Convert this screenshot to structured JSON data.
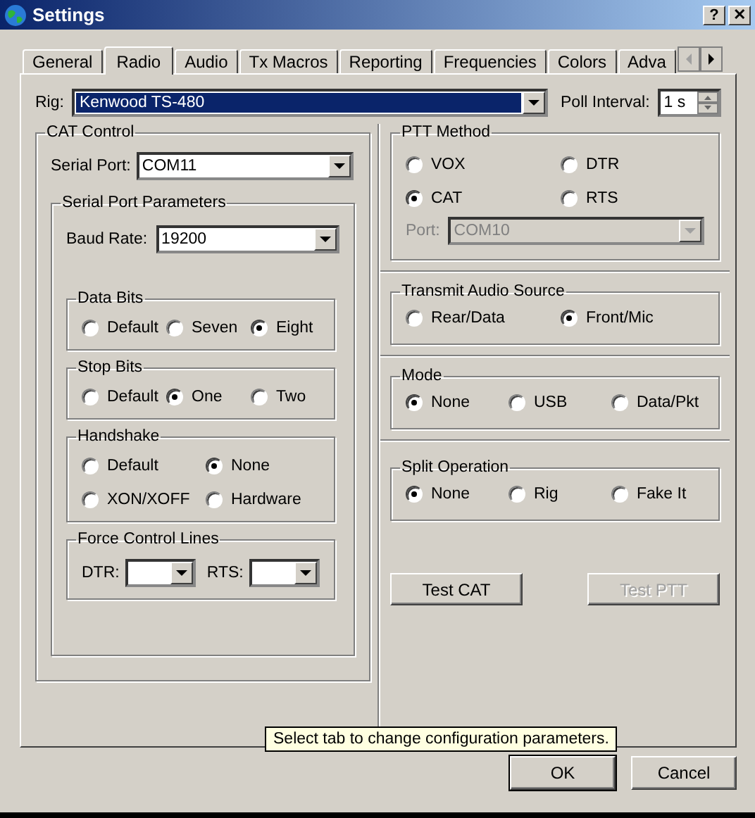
{
  "window": {
    "title": "Settings",
    "title_buttons": [
      "?",
      "✕"
    ]
  },
  "tabs": [
    {
      "label": "General",
      "selected": false
    },
    {
      "label": "Radio",
      "selected": true
    },
    {
      "label": "Audio",
      "selected": false
    },
    {
      "label": "Tx Macros",
      "selected": false
    },
    {
      "label": "Reporting",
      "selected": false
    },
    {
      "label": "Frequencies",
      "selected": false
    },
    {
      "label": "Colors",
      "selected": false
    },
    {
      "label": "Adva",
      "selected": false
    }
  ],
  "rig": {
    "label": "Rig:",
    "value": "Kenwood TS-480"
  },
  "poll_interval": {
    "label": "Poll Interval:",
    "value": "1 s"
  },
  "cat_control": {
    "title": "CAT Control",
    "serial_port": {
      "label": "Serial Port:",
      "value": "COM11"
    },
    "serial_port_parameters": {
      "title": "Serial Port Parameters",
      "baud_rate": {
        "label": "Baud Rate:",
        "value": "19200"
      },
      "groups": [
        {
          "title": "Data Bits",
          "options": [
            {
              "label": "Default",
              "selected": false
            },
            {
              "label": "Seven",
              "selected": false
            },
            {
              "label": "Eight",
              "selected": true
            }
          ]
        },
        {
          "title": "Stop Bits",
          "options": [
            {
              "label": "Default",
              "selected": false
            },
            {
              "label": "One",
              "selected": true
            },
            {
              "label": "Two",
              "selected": false
            }
          ]
        },
        {
          "title": "Handshake",
          "options": [
            {
              "label": "Default",
              "selected": false
            },
            {
              "label": "None",
              "selected": true
            },
            {
              "label": "XON/XOFF",
              "selected": false
            },
            {
              "label": "Hardware",
              "selected": false
            }
          ]
        }
      ],
      "force_control_lines": {
        "title": "Force Control Lines",
        "dtr": {
          "label": "DTR:"
        },
        "rts": {
          "label": "RTS:"
        }
      }
    }
  },
  "ptt_method": {
    "title": "PTT Method",
    "options": [
      {
        "label": "VOX",
        "selected": false
      },
      {
        "label": "DTR",
        "selected": false
      },
      {
        "label": "CAT",
        "selected": true
      },
      {
        "label": "RTS",
        "selected": false
      }
    ],
    "port": {
      "label": "Port:",
      "value": "COM10",
      "disabled": true
    }
  },
  "settings_groups": [
    {
      "title": "Transmit Audio Source",
      "options": [
        {
          "label": "Rear/Data",
          "selected": false
        },
        {
          "label": "Front/Mic",
          "selected": true
        }
      ]
    },
    {
      "title": "Mode",
      "options": [
        {
          "label": "None",
          "selected": true
        },
        {
          "label": "USB",
          "selected": false
        },
        {
          "label": "Data/Pkt",
          "selected": false
        }
      ]
    },
    {
      "title": "Split Operation",
      "options": [
        {
          "label": "None",
          "selected": true
        },
        {
          "label": "Rig",
          "selected": false
        },
        {
          "label": "Fake It",
          "selected": false
        }
      ]
    }
  ],
  "test_buttons": [
    {
      "label": "Test CAT",
      "disabled": false
    },
    {
      "label": "Test PTT",
      "disabled": true
    }
  ],
  "tooltip": "Select tab to change configuration parameters.",
  "dialog_buttons": [
    {
      "label": "OK",
      "default": true
    },
    {
      "label": "Cancel",
      "default": false
    }
  ]
}
